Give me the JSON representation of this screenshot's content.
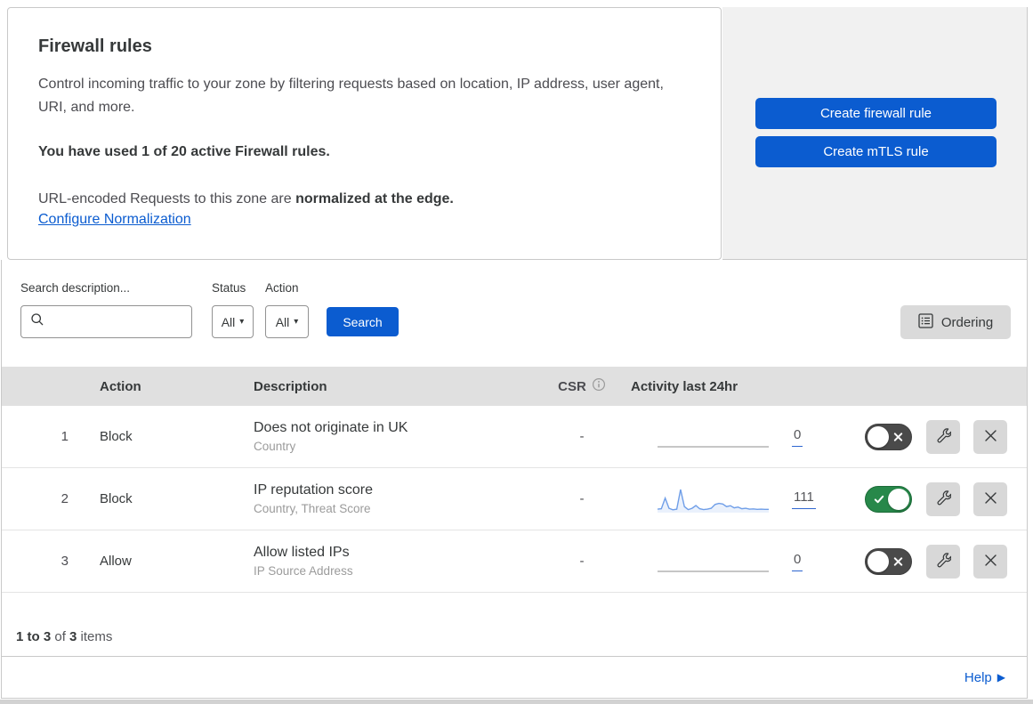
{
  "header": {
    "title": "Firewall rules",
    "description": "Control incoming traffic to your zone by filtering requests based on location, IP address, user agent, URI, and more.",
    "usage": "You have used 1 of 20 active Firewall rules.",
    "norm_text": "URL-encoded Requests to this zone are ",
    "norm_bold": "normalized at the edge.",
    "norm_link": "Configure Normalization",
    "create_firewall": "Create firewall rule",
    "create_mtls": "Create mTLS rule"
  },
  "filters": {
    "search_label": "Search description...",
    "status_label": "Status",
    "status_value": "All",
    "action_label": "Action",
    "action_value": "All",
    "search_button": "Search",
    "ordering_button": "Ordering"
  },
  "icons": {
    "caret": "▾",
    "help_arrow": "▶"
  },
  "table": {
    "columns": [
      "Action",
      "Description",
      "CSR",
      "Activity last 24hr"
    ],
    "rows": [
      {
        "index": "1",
        "action": "Block",
        "description": "Does not originate in UK",
        "criteria": "Country",
        "csr": "-",
        "activity_count": "0",
        "enabled": false,
        "sparkline": []
      },
      {
        "index": "2",
        "action": "Block",
        "description": "IP reputation score",
        "criteria": "Country, Threat Score",
        "csr": "-",
        "activity_count": "111",
        "enabled": true,
        "sparkline": [
          8,
          10,
          60,
          12,
          5,
          8,
          100,
          20,
          6,
          12,
          25,
          10,
          6,
          8,
          12,
          30,
          35,
          32,
          20,
          24,
          14,
          18,
          10,
          12,
          8,
          9,
          7,
          8,
          7,
          7
        ]
      },
      {
        "index": "3",
        "action": "Allow",
        "description": "Allow listed IPs",
        "criteria": "IP Source Address",
        "csr": "-",
        "activity_count": "0",
        "enabled": false,
        "sparkline": []
      }
    ],
    "footer": {
      "range": "1 to 3",
      "of": " of ",
      "total": "3",
      "items": " items"
    }
  },
  "help": {
    "label": "Help"
  },
  "colors": {
    "accent": "#0b5cd0",
    "toggle_on": "#27884a",
    "toggle_off": "#4a4a4a",
    "sparkline": "#6f9ee8"
  }
}
